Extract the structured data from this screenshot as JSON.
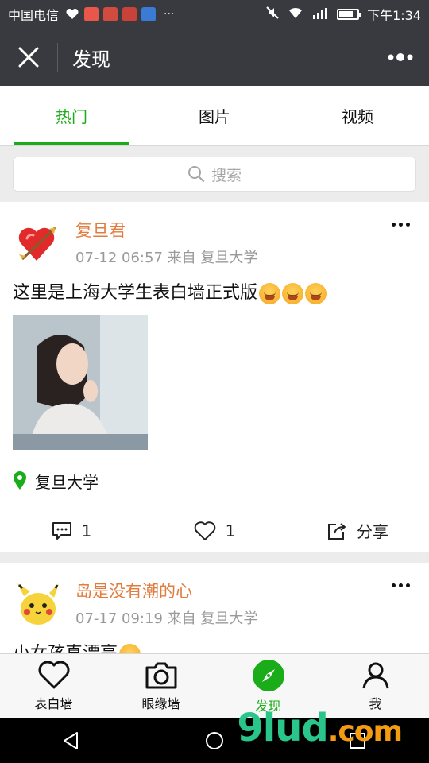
{
  "status_bar": {
    "carrier": "中国电信",
    "time": "下午1:34",
    "more_indicator": "···"
  },
  "header": {
    "title": "发现",
    "close_icon": "close-icon",
    "more_icon": "more-icon"
  },
  "tabs": [
    {
      "label": "热门",
      "active": true
    },
    {
      "label": "图片",
      "active": false
    },
    {
      "label": "视频",
      "active": false
    }
  ],
  "search": {
    "placeholder": "搜索"
  },
  "posts": [
    {
      "author": "复旦君",
      "meta": "07-12 06:57 来自 复旦大学",
      "text": "这里是上海大学生表白墙正式版",
      "location": "复旦大学",
      "comments": "1",
      "likes": "1",
      "share": "分享"
    },
    {
      "author": "岛是没有潮的心",
      "meta": "07-17 09:19 来自 复旦大学",
      "text": "小女孩真漂亮"
    }
  ],
  "bottom_nav": [
    {
      "label": "表白墙",
      "icon": "heart-icon",
      "active": false
    },
    {
      "label": "眼缘墙",
      "icon": "camera-icon",
      "active": false
    },
    {
      "label": "发现",
      "icon": "compass-icon",
      "active": true
    },
    {
      "label": "我",
      "icon": "person-icon",
      "active": false
    }
  ],
  "watermark": {
    "text": "9lud",
    "suffix": ".com"
  },
  "colors": {
    "accent": "#1aad19",
    "author": "#e07c3e",
    "header_bg": "#393a3f"
  }
}
